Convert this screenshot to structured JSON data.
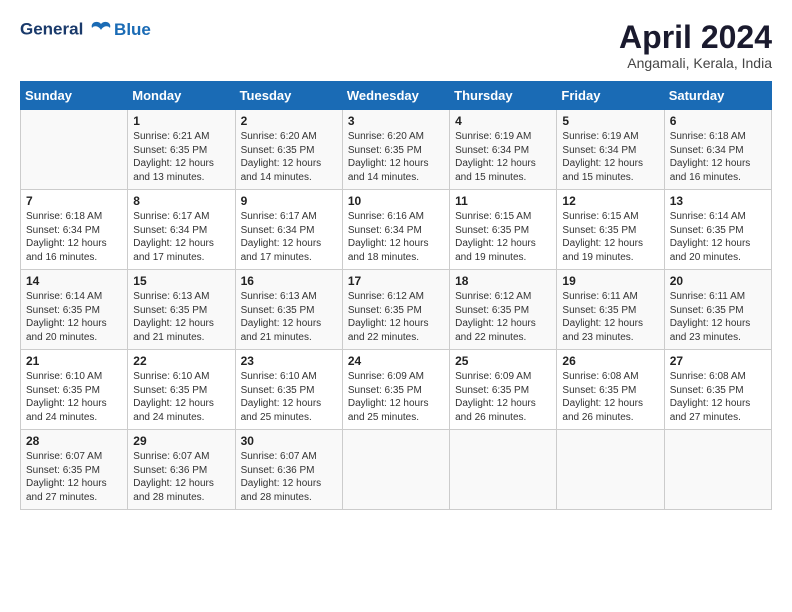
{
  "logo": {
    "line1": "General",
    "line2": "Blue"
  },
  "title": "April 2024",
  "location": "Angamali, Kerala, India",
  "days_of_week": [
    "Sunday",
    "Monday",
    "Tuesday",
    "Wednesday",
    "Thursday",
    "Friday",
    "Saturday"
  ],
  "weeks": [
    [
      {
        "day": "",
        "sunrise": "",
        "sunset": "",
        "daylight": ""
      },
      {
        "day": "1",
        "sunrise": "6:21 AM",
        "sunset": "6:35 PM",
        "daylight": "12 hours and 13 minutes."
      },
      {
        "day": "2",
        "sunrise": "6:20 AM",
        "sunset": "6:35 PM",
        "daylight": "12 hours and 14 minutes."
      },
      {
        "day": "3",
        "sunrise": "6:20 AM",
        "sunset": "6:35 PM",
        "daylight": "12 hours and 14 minutes."
      },
      {
        "day": "4",
        "sunrise": "6:19 AM",
        "sunset": "6:34 PM",
        "daylight": "12 hours and 15 minutes."
      },
      {
        "day": "5",
        "sunrise": "6:19 AM",
        "sunset": "6:34 PM",
        "daylight": "12 hours and 15 minutes."
      },
      {
        "day": "6",
        "sunrise": "6:18 AM",
        "sunset": "6:34 PM",
        "daylight": "12 hours and 16 minutes."
      }
    ],
    [
      {
        "day": "7",
        "sunrise": "6:18 AM",
        "sunset": "6:34 PM",
        "daylight": "12 hours and 16 minutes."
      },
      {
        "day": "8",
        "sunrise": "6:17 AM",
        "sunset": "6:34 PM",
        "daylight": "12 hours and 17 minutes."
      },
      {
        "day": "9",
        "sunrise": "6:17 AM",
        "sunset": "6:34 PM",
        "daylight": "12 hours and 17 minutes."
      },
      {
        "day": "10",
        "sunrise": "6:16 AM",
        "sunset": "6:34 PM",
        "daylight": "12 hours and 18 minutes."
      },
      {
        "day": "11",
        "sunrise": "6:15 AM",
        "sunset": "6:35 PM",
        "daylight": "12 hours and 19 minutes."
      },
      {
        "day": "12",
        "sunrise": "6:15 AM",
        "sunset": "6:35 PM",
        "daylight": "12 hours and 19 minutes."
      },
      {
        "day": "13",
        "sunrise": "6:14 AM",
        "sunset": "6:35 PM",
        "daylight": "12 hours and 20 minutes."
      }
    ],
    [
      {
        "day": "14",
        "sunrise": "6:14 AM",
        "sunset": "6:35 PM",
        "daylight": "12 hours and 20 minutes."
      },
      {
        "day": "15",
        "sunrise": "6:13 AM",
        "sunset": "6:35 PM",
        "daylight": "12 hours and 21 minutes."
      },
      {
        "day": "16",
        "sunrise": "6:13 AM",
        "sunset": "6:35 PM",
        "daylight": "12 hours and 21 minutes."
      },
      {
        "day": "17",
        "sunrise": "6:12 AM",
        "sunset": "6:35 PM",
        "daylight": "12 hours and 22 minutes."
      },
      {
        "day": "18",
        "sunrise": "6:12 AM",
        "sunset": "6:35 PM",
        "daylight": "12 hours and 22 minutes."
      },
      {
        "day": "19",
        "sunrise": "6:11 AM",
        "sunset": "6:35 PM",
        "daylight": "12 hours and 23 minutes."
      },
      {
        "day": "20",
        "sunrise": "6:11 AM",
        "sunset": "6:35 PM",
        "daylight": "12 hours and 23 minutes."
      }
    ],
    [
      {
        "day": "21",
        "sunrise": "6:10 AM",
        "sunset": "6:35 PM",
        "daylight": "12 hours and 24 minutes."
      },
      {
        "day": "22",
        "sunrise": "6:10 AM",
        "sunset": "6:35 PM",
        "daylight": "12 hours and 24 minutes."
      },
      {
        "day": "23",
        "sunrise": "6:10 AM",
        "sunset": "6:35 PM",
        "daylight": "12 hours and 25 minutes."
      },
      {
        "day": "24",
        "sunrise": "6:09 AM",
        "sunset": "6:35 PM",
        "daylight": "12 hours and 25 minutes."
      },
      {
        "day": "25",
        "sunrise": "6:09 AM",
        "sunset": "6:35 PM",
        "daylight": "12 hours and 26 minutes."
      },
      {
        "day": "26",
        "sunrise": "6:08 AM",
        "sunset": "6:35 PM",
        "daylight": "12 hours and 26 minutes."
      },
      {
        "day": "27",
        "sunrise": "6:08 AM",
        "sunset": "6:35 PM",
        "daylight": "12 hours and 27 minutes."
      }
    ],
    [
      {
        "day": "28",
        "sunrise": "6:07 AM",
        "sunset": "6:35 PM",
        "daylight": "12 hours and 27 minutes."
      },
      {
        "day": "29",
        "sunrise": "6:07 AM",
        "sunset": "6:36 PM",
        "daylight": "12 hours and 28 minutes."
      },
      {
        "day": "30",
        "sunrise": "6:07 AM",
        "sunset": "6:36 PM",
        "daylight": "12 hours and 28 minutes."
      },
      {
        "day": "",
        "sunrise": "",
        "sunset": "",
        "daylight": ""
      },
      {
        "day": "",
        "sunrise": "",
        "sunset": "",
        "daylight": ""
      },
      {
        "day": "",
        "sunrise": "",
        "sunset": "",
        "daylight": ""
      },
      {
        "day": "",
        "sunrise": "",
        "sunset": "",
        "daylight": ""
      }
    ]
  ]
}
